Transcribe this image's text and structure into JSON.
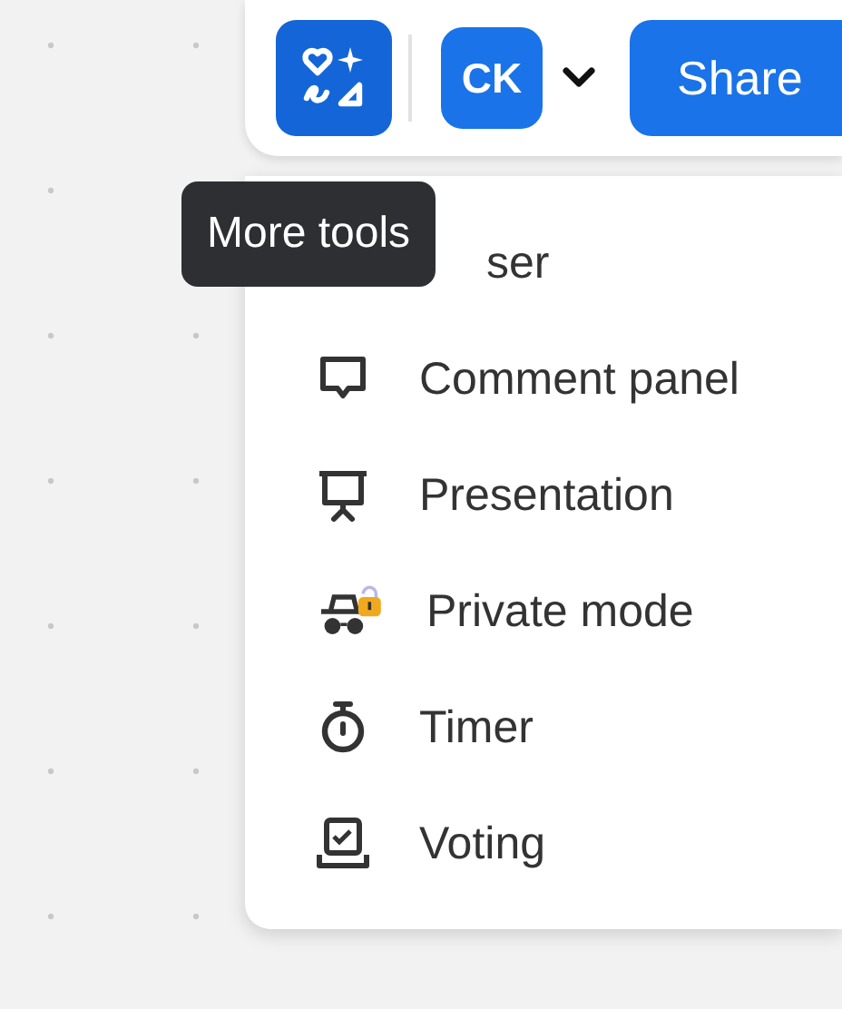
{
  "toolbar": {
    "avatar": "CK",
    "share": "Share"
  },
  "tooltip": "More tools",
  "menu": [
    {
      "label": "ser",
      "kind": "partial"
    },
    {
      "label": "Comment panel",
      "kind": "comment"
    },
    {
      "label": "Presentation",
      "kind": "presentation"
    },
    {
      "label": "Private mode",
      "kind": "private"
    },
    {
      "label": "Timer",
      "kind": "timer"
    },
    {
      "label": "Voting",
      "kind": "voting"
    }
  ]
}
